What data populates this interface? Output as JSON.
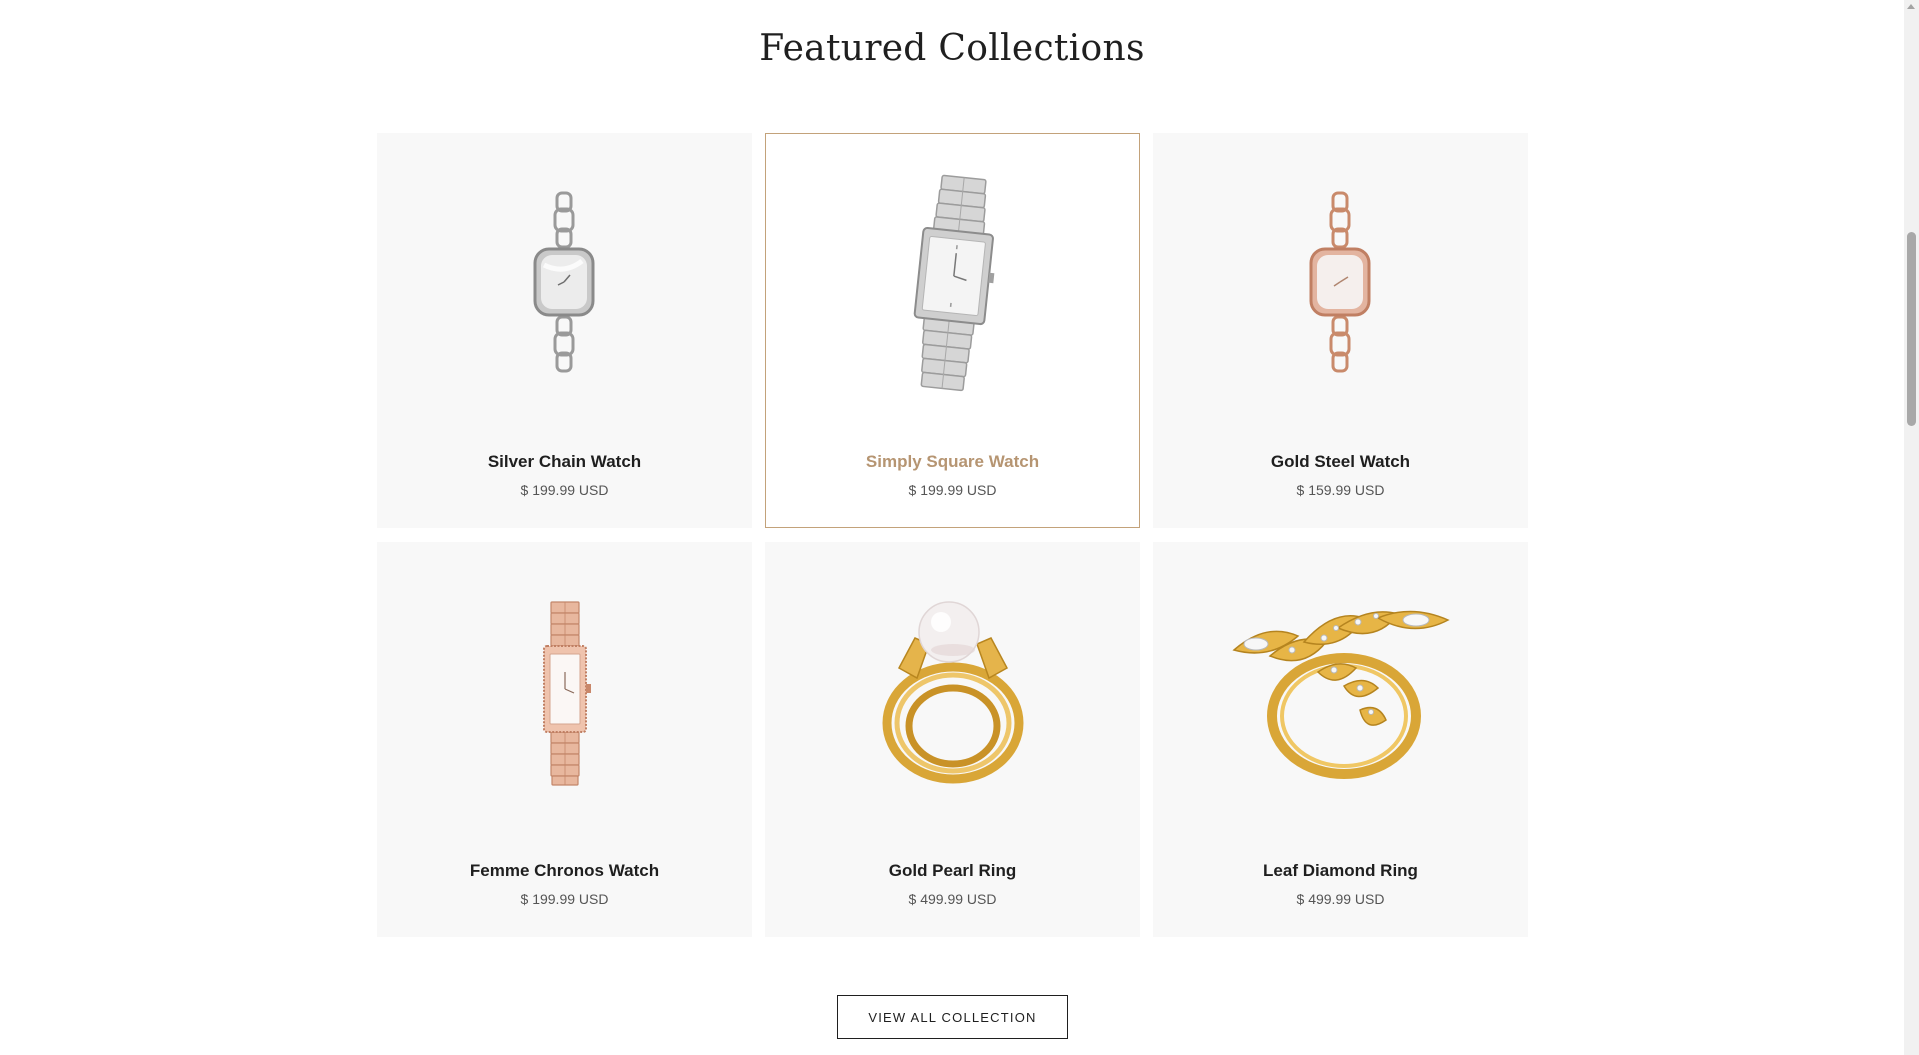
{
  "section": {
    "title": "Featured Collections"
  },
  "products": [
    {
      "name": "Silver Chain Watch",
      "price": "$ 199.99 USD",
      "icon": "silver-chain-watch-image",
      "active": false
    },
    {
      "name": "Simply Square Watch",
      "price": "$ 199.99 USD",
      "icon": "simply-square-watch-image",
      "active": true
    },
    {
      "name": "Gold Steel Watch",
      "price": "$ 159.99 USD",
      "icon": "gold-steel-watch-image",
      "active": false
    },
    {
      "name": "Femme Chronos Watch",
      "price": "$ 199.99 USD",
      "icon": "femme-chronos-watch-image",
      "active": false
    },
    {
      "name": "Gold Pearl Ring",
      "price": "$ 499.99 USD",
      "icon": "gold-pearl-ring-image",
      "active": false
    },
    {
      "name": "Leaf Diamond Ring",
      "price": "$ 499.99 USD",
      "icon": "leaf-diamond-ring-image",
      "active": false
    }
  ],
  "cta": {
    "label": "VIEW ALL COLLECTION"
  },
  "colors": {
    "accent": "#c3a27a",
    "accent_text": "#b69572",
    "card_bg": "#f8f8f8",
    "text": "#1f1f1f",
    "muted": "#555555"
  }
}
